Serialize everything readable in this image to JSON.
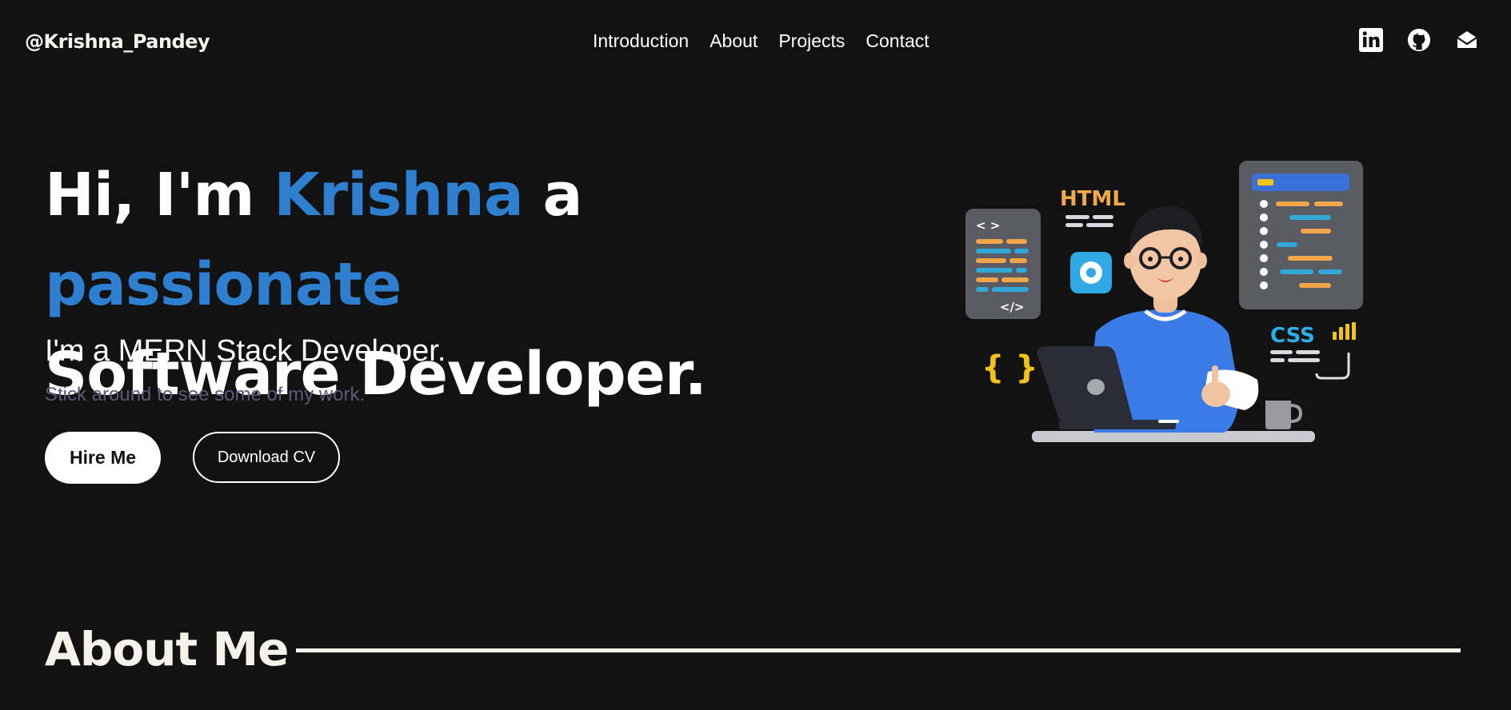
{
  "header": {
    "brand": "@Krishna_Pandey",
    "nav": [
      {
        "label": "Introduction"
      },
      {
        "label": "About"
      },
      {
        "label": "Projects"
      },
      {
        "label": "Contact"
      }
    ],
    "social_icons": [
      "linkedin-icon",
      "github-icon",
      "mail-icon"
    ]
  },
  "hero": {
    "title_part1": "Hi, I'm ",
    "title_name": "Krishna",
    "title_part2": " a ",
    "title_accent": "passionate",
    "title_line2": "Software Developer.",
    "subtitle": "I'm a MERN Stack Developer.",
    "tagline": "Stick around to see some of my work.",
    "hire_label": "Hire Me",
    "cv_label": "Download CV",
    "accent_color": "#2f7fd1"
  },
  "illustration": {
    "html_label": "HTML",
    "css_label": "CSS",
    "braces": "{ }",
    "open_tag": "< >",
    "close_tag": "</>"
  },
  "about": {
    "title": "About Me"
  }
}
